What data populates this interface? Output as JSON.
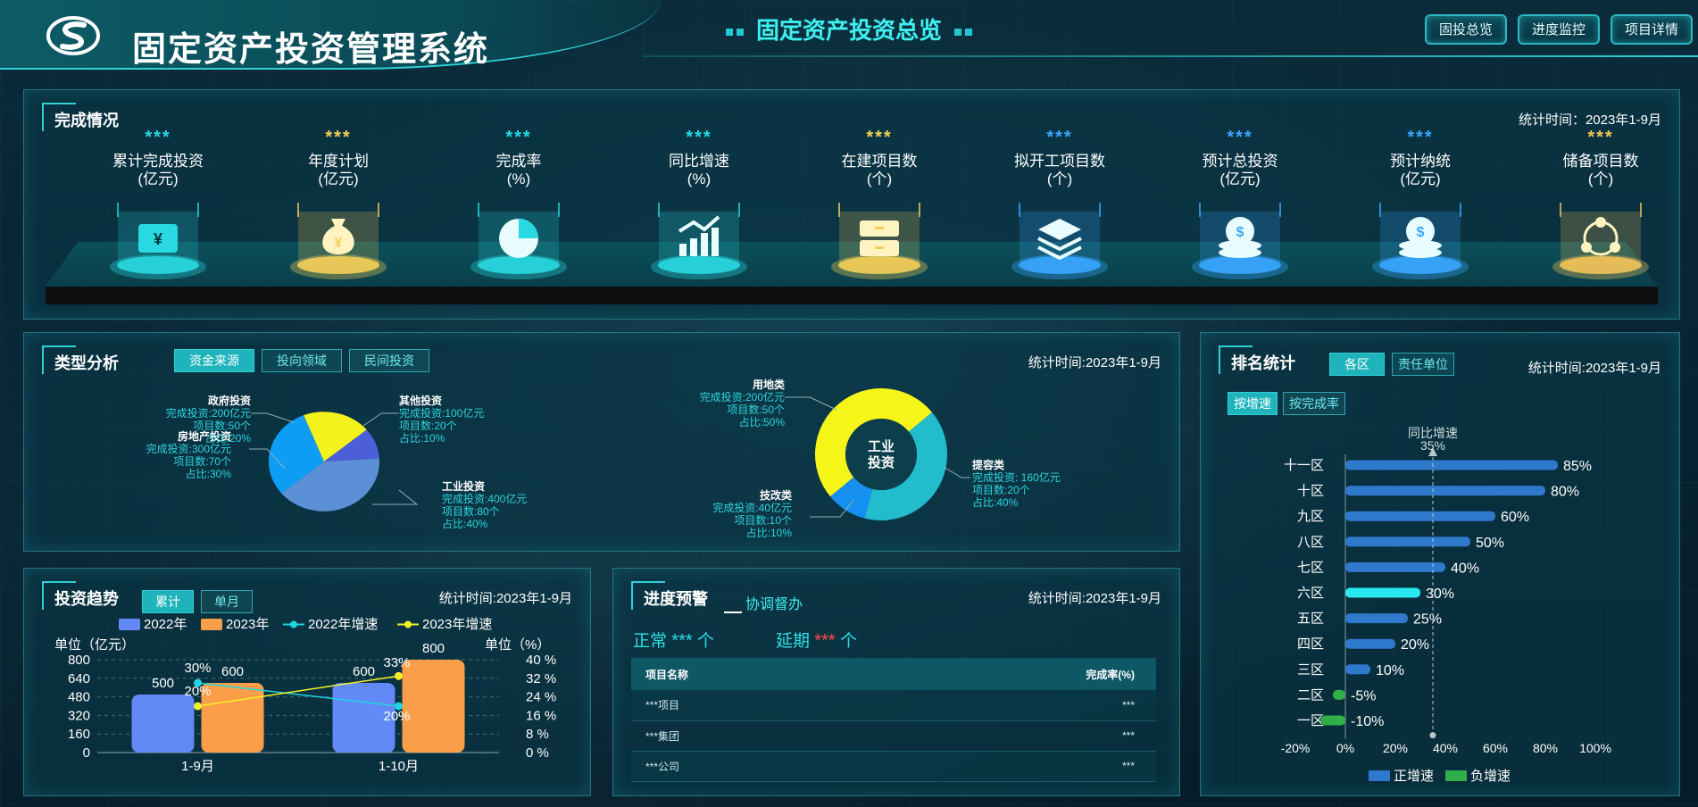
{
  "header": {
    "system_title": "固定资产投资管理系统",
    "center_title": "固定资产投资总览",
    "nav": [
      "固投总览",
      "进度监控",
      "项目详情"
    ]
  },
  "completion": {
    "title": "完成情况",
    "stat": "统计时间：2023年1-9月",
    "items": [
      {
        "value": "***",
        "label1": "累计完成投资",
        "label2": "(亿元)",
        "icon": "wallet-icon",
        "color": "#29d8e0"
      },
      {
        "value": "***",
        "label1": "年度计划",
        "label2": "(亿元)",
        "icon": "money-bag-icon",
        "color": "#f4cf58"
      },
      {
        "value": "***",
        "label1": "完成率",
        "label2": "(%)",
        "icon": "pie-icon",
        "color": "#29d8e0"
      },
      {
        "value": "***",
        "label1": "同比增速",
        "label2": "(%)",
        "icon": "growth-chart-icon",
        "color": "#29d8e0"
      },
      {
        "value": "***",
        "label1": "在建项目数",
        "label2": "(个)",
        "icon": "cabinet-icon",
        "color": "#f4cf58"
      },
      {
        "value": "***",
        "label1": "拟开工项目数",
        "label2": "(个)",
        "icon": "layers-icon",
        "color": "#3aa6ff"
      },
      {
        "value": "***",
        "label1": "预计总投资",
        "label2": "(亿元)",
        "icon": "coin-stack-icon",
        "color": "#3aa6ff"
      },
      {
        "value": "***",
        "label1": "预计纳统",
        "label2": "(亿元)",
        "icon": "coin-stack-icon",
        "color": "#3aa6ff"
      },
      {
        "value": "***",
        "label1": "储备项目数",
        "label2": "(个)",
        "icon": "cycle-icon",
        "color": "#f2c35a"
      }
    ]
  },
  "type_analysis": {
    "title": "类型分析",
    "stat": "统计时间:2023年1-9月",
    "tabs": [
      "资金来源",
      "投向领域",
      "民间投资"
    ],
    "center_label1": "工业",
    "center_label2": "投资"
  },
  "ranking": {
    "title": "排名统计",
    "stat": "统计时间:2023年1-9月",
    "tabs": [
      "各区",
      "责任单位"
    ],
    "subtabs": [
      "按增速",
      "按完成率"
    ],
    "ref_label": "同比增速",
    "ref_value": "35%",
    "legend_pos": "正增速",
    "legend_neg": "负增速"
  },
  "trend": {
    "title": "投资趋势",
    "stat": "统计时间:2023年1-9月",
    "tabs": [
      "累计",
      "单月"
    ],
    "unit_left": "单位（亿元）",
    "unit_right": "单位（%）"
  },
  "progress": {
    "title": "进度预警",
    "tab2": "协调督办",
    "stat": "统计时间:2023年1-9月",
    "normal_label": "正常",
    "normal_value": "***",
    "normal_unit": "个",
    "delay_label": "延期",
    "delay_value": "***",
    "delay_unit": "个",
    "columns": [
      "项目名称",
      "完成率(%)"
    ],
    "rows": [
      [
        "***项目",
        "***"
      ],
      [
        "***集团",
        "***"
      ],
      [
        "***公司",
        "***"
      ]
    ]
  },
  "chart_data": [
    {
      "type": "pie",
      "title": "",
      "slices": [
        {
          "name": "工业投资",
          "lines": [
            "完成投资:400亿元",
            "项目数:80个",
            "占比:40%"
          ],
          "value": 40,
          "color": "#5b8fd6"
        },
        {
          "name": "房地产投资",
          "lines": [
            "完成投资:300亿元",
            "项目数:70个",
            "占比:30%"
          ],
          "value": 30,
          "color": "#0e9df4"
        },
        {
          "name": "政府投资",
          "lines": [
            "完成投资:200亿元",
            "项目数:50个",
            "占比:20%"
          ],
          "value": 20,
          "color": "#f3f21d"
        },
        {
          "name": "其他投资",
          "lines": [
            "完成投资:100亿元",
            "项目数:20个",
            "占比:10%"
          ],
          "value": 10,
          "color": "#4d5fd8"
        }
      ]
    },
    {
      "type": "pie",
      "title": "",
      "slices": [
        {
          "name": "提容类",
          "lines": [
            "完成投资: 160亿元",
            "项目数:20个",
            "占比:40%"
          ],
          "value": 40,
          "color": "#22bccd"
        },
        {
          "name": "技改类",
          "lines": [
            "完成投资:40亿元",
            "项目数:10个",
            "占比:10%"
          ],
          "value": 10,
          "color": "#1590f0"
        },
        {
          "name": "用地类",
          "lines": [
            "完成投资:200亿元",
            "项目数:50个",
            "占比:50%"
          ],
          "value": 50,
          "color": "#f6f51a"
        }
      ]
    },
    {
      "type": "bar",
      "title": "",
      "categories": [
        "十一区",
        "十区",
        "九区",
        "八区",
        "七区",
        "六区",
        "五区",
        "四区",
        "三区",
        "二区",
        "一区"
      ],
      "values": [
        85,
        80,
        60,
        50,
        40,
        30,
        25,
        20,
        10,
        -5,
        -10
      ],
      "value_labels": [
        "85%",
        "80%",
        "60%",
        "50%",
        "40%",
        "30%",
        "25%",
        "20%",
        "10%",
        "-5%",
        "-10%"
      ],
      "x_ticks": [
        "-20%",
        "0%",
        "20%",
        "40%",
        "60%",
        "80%",
        "100%"
      ],
      "xlim": [
        -20,
        100
      ],
      "reference_value": 35,
      "highlight": "六区",
      "colors": {
        "pos": "#2f79cc",
        "neg": "#2fae4a",
        "highlight": "#27e9ef"
      }
    },
    {
      "type": "bar",
      "title": "",
      "categories": [
        "1-9月",
        "1-10月"
      ],
      "series": [
        {
          "name": "2022年",
          "kind": "bar",
          "values": [
            500,
            600
          ],
          "labels": [
            "500",
            "600"
          ],
          "color": "#6289f6"
        },
        {
          "name": "2023年",
          "kind": "bar",
          "values": [
            600,
            800
          ],
          "labels": [
            "600",
            "800"
          ],
          "color": "#fb9e4a"
        },
        {
          "name": "2022年增速",
          "kind": "line",
          "values": [
            30,
            20
          ],
          "labels": [
            "30%",
            "20%"
          ],
          "color": "#1fd6de"
        },
        {
          "name": "2023年增速",
          "kind": "line",
          "values": [
            20,
            33
          ],
          "labels": [
            "20%",
            "33%"
          ],
          "color": "#f5ef2a"
        }
      ],
      "ylim": [
        0,
        800
      ],
      "y_ticks": [
        "0",
        "160",
        "320",
        "480",
        "640",
        "800"
      ],
      "y2lim": [
        0,
        40
      ],
      "y2_ticks": [
        "0 %",
        "8 %",
        "16 %",
        "24 %",
        "32 %",
        "40 %"
      ]
    }
  ]
}
